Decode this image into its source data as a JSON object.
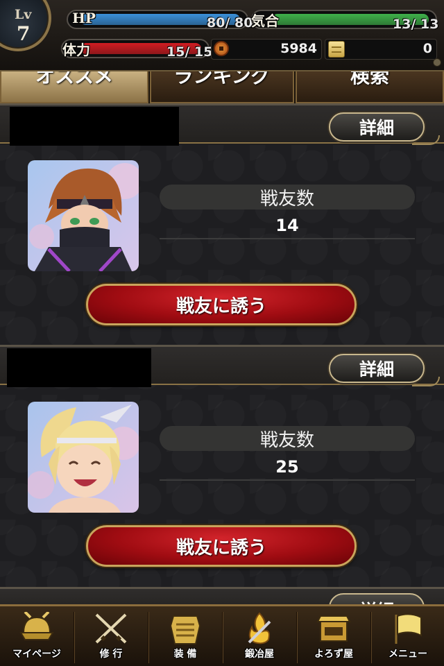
{
  "status": {
    "level_label": "Lv",
    "level_value": "7",
    "hp_label": "HP",
    "hp_value": "80/ 80",
    "hp_fill": 1.0,
    "kiai_label": "気合",
    "kiai_value": "13/ 13",
    "kiai_fill": 1.0,
    "stamina_label": "体力",
    "stamina_value": "15/ 15",
    "stamina_fill": 1.0,
    "coins": "5984",
    "gold": "0",
    "colors": {
      "hp": "#3a8fd8",
      "kiai": "#3fb04a",
      "stamina": "#d01c22"
    }
  },
  "tabs": [
    {
      "label": "オススメ",
      "active": true
    },
    {
      "label": "ランキング",
      "active": false
    },
    {
      "label": "検索",
      "active": false
    }
  ],
  "cards": [
    {
      "detail_label": "詳細",
      "stat_label": "戦友数",
      "stat_value": "14",
      "invite_label": "戦友に誘う",
      "avatar": "ninja-avatar"
    },
    {
      "detail_label": "詳細",
      "stat_label": "戦友数",
      "stat_value": "25",
      "invite_label": "戦友に誘う",
      "avatar": "blonde-girl-avatar"
    }
  ],
  "partial_card": {
    "detail_label": "詳細"
  },
  "nav": [
    {
      "label": "マイページ",
      "icon": "helmet-icon"
    },
    {
      "label": "修 行",
      "icon": "crossed-swords-icon"
    },
    {
      "label": "装 備",
      "icon": "armor-icon"
    },
    {
      "label": "鍛冶屋",
      "icon": "forge-icon"
    },
    {
      "label": "よろず屋",
      "icon": "shop-icon"
    },
    {
      "label": "メニュー",
      "icon": "flag-icon"
    }
  ]
}
